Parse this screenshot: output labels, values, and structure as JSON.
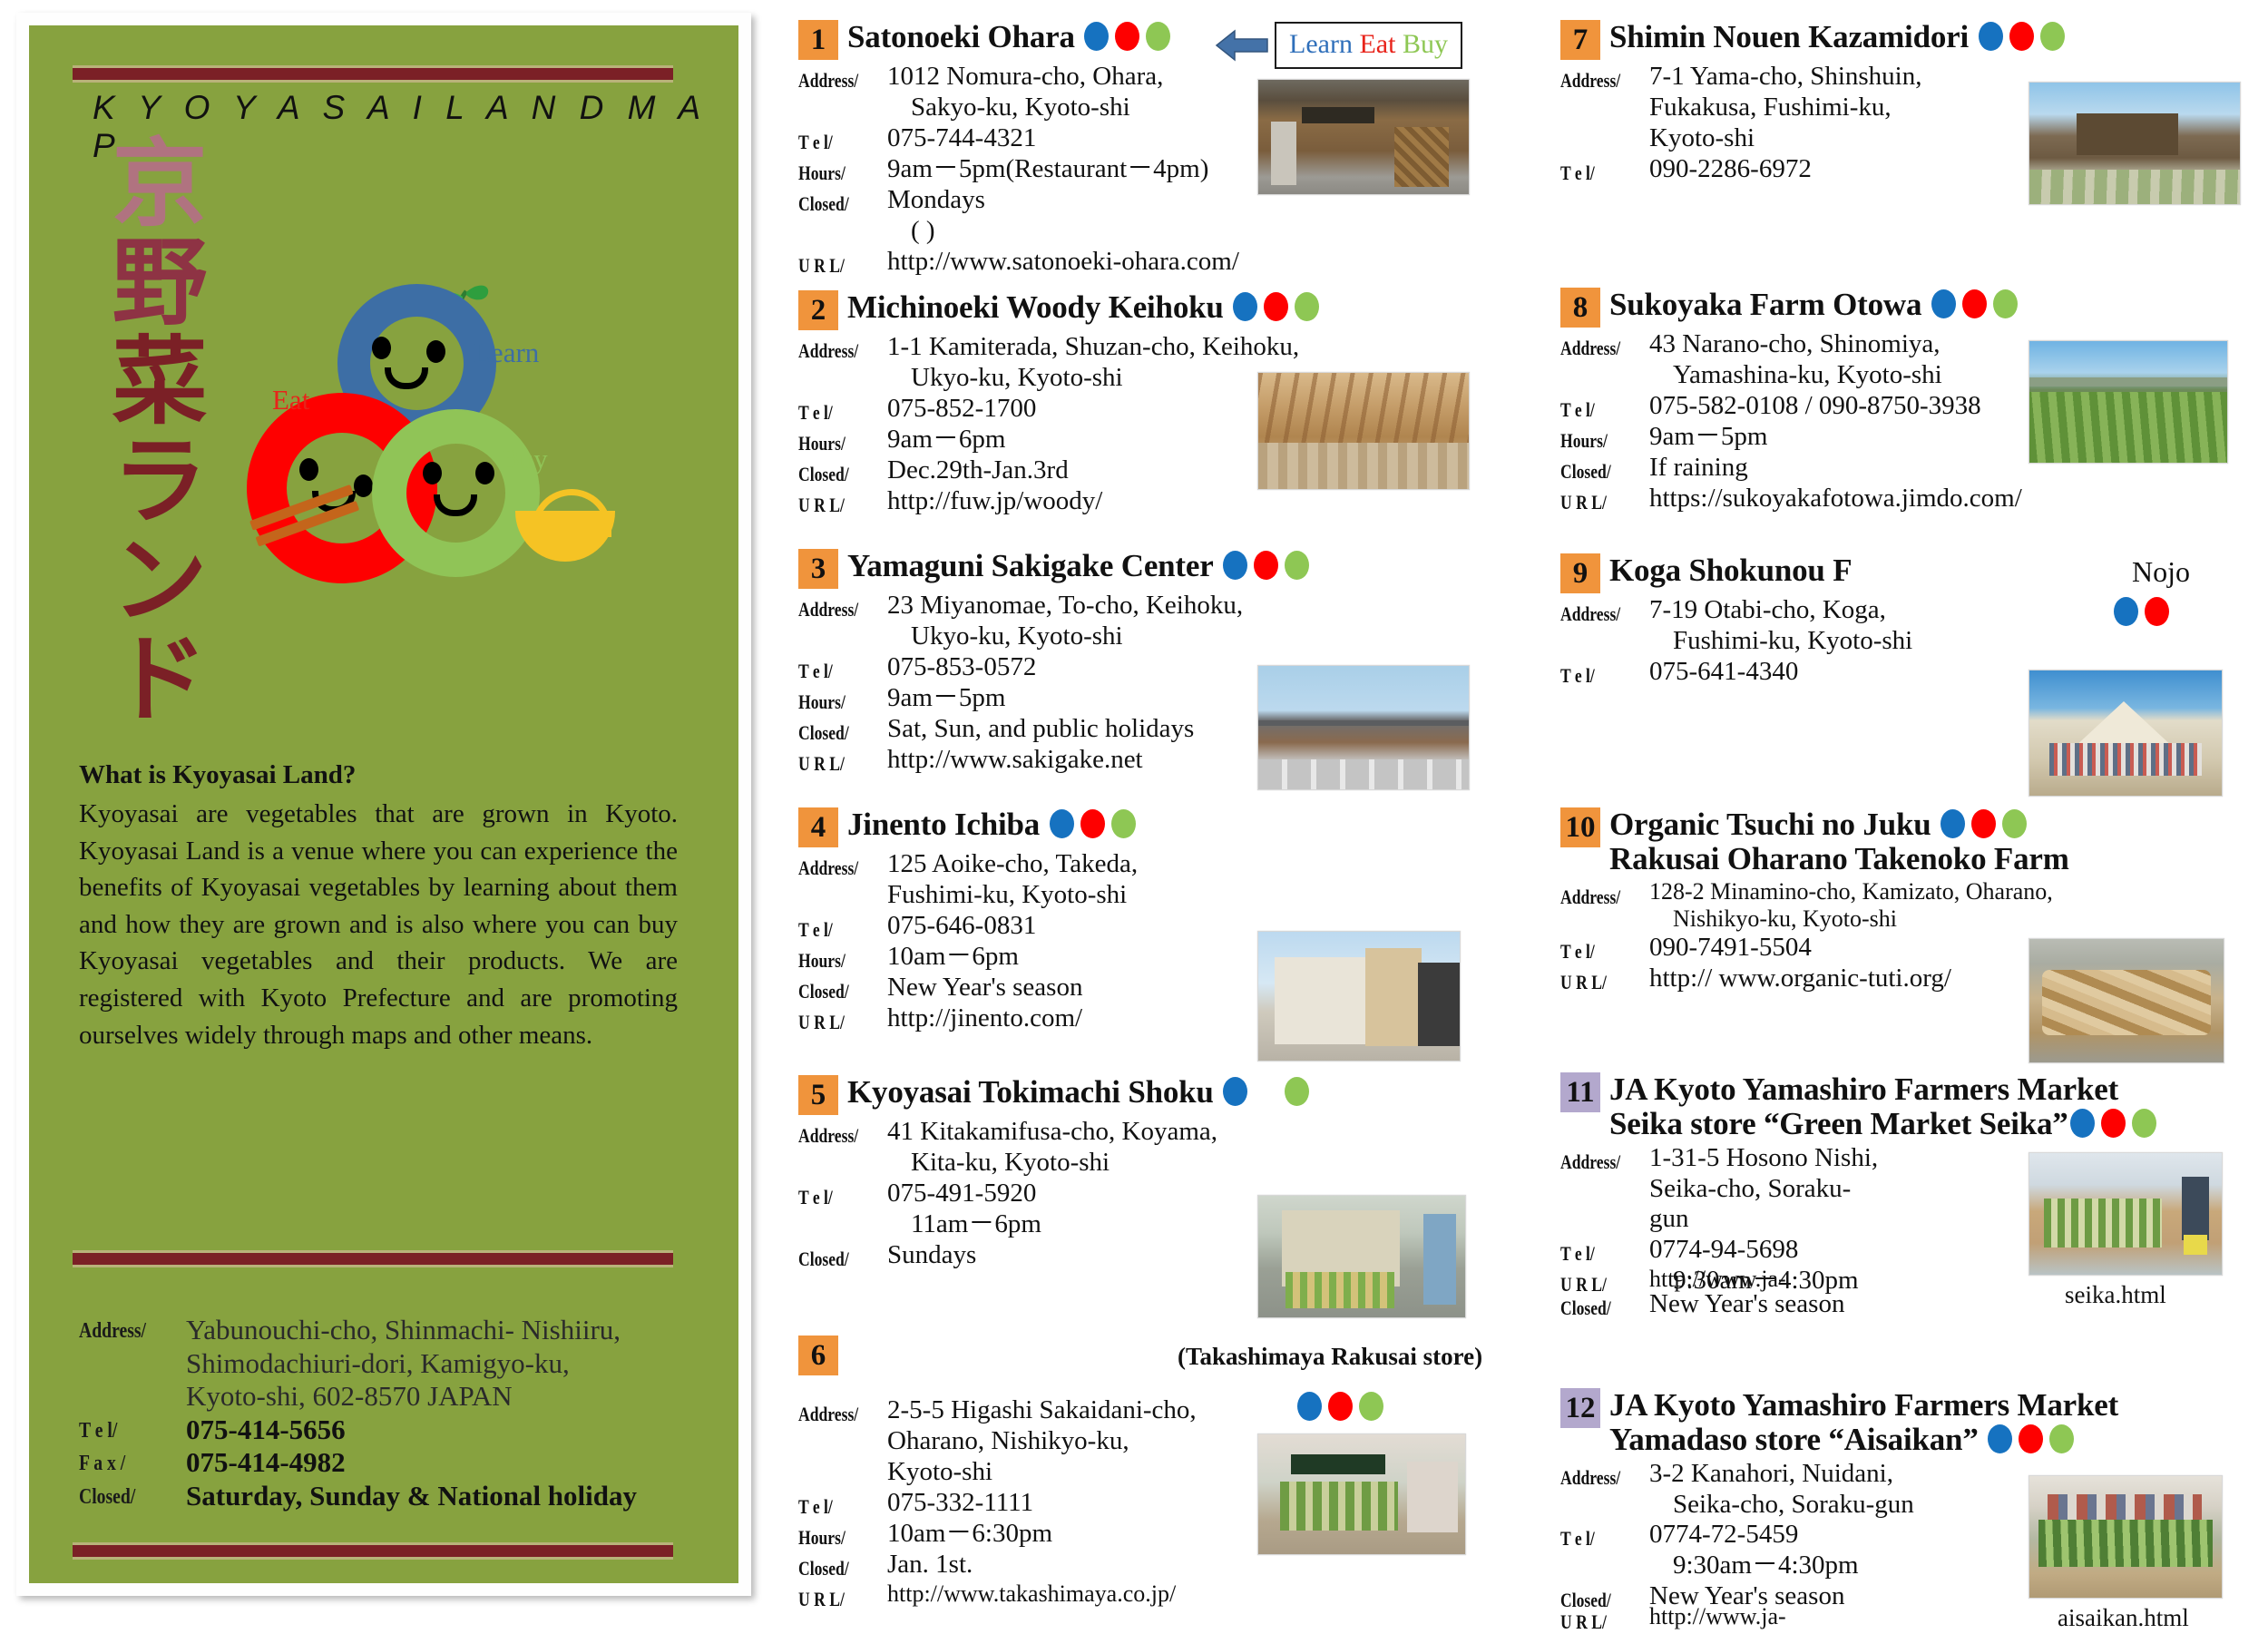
{
  "left_panel": {
    "romaji_title": "K Y O Y A S A I   L A N D   M A P",
    "kanji_lines": [
      "京",
      "野",
      "菜",
      "ラ",
      "ン",
      "ド"
    ],
    "mascot_labels": {
      "learn": "Learn",
      "eat": "Eat",
      "buy": "Buy"
    },
    "about": {
      "heading": "What is Kyoyasai Land?",
      "body": "Kyoyasai are vegetables that are grown in Kyoto. Kyoyasai Land is a venue where you can experience the benefits of Kyoyasai vegetables by learning about them and how they are grown and is also where you can buy Kyoyasai vegetables and their products. We are registered with Kyoto Prefecture and are promoting ourselves widely through maps and other means."
    },
    "contact": {
      "address_label": "Address/",
      "address_l1": "Yabunouchi-cho, Shinmachi- Nishiiru,",
      "address_l2": "Shimodachiuri-dori, Kamigyo-ku,",
      "address_l3": "Kyoto-shi, 602-8570 JAPAN",
      "tel_label": "T e l/",
      "tel": "075-414-5656",
      "fax_label": "F a x /",
      "fax": "075-414-4982",
      "closed_label": "Closed/",
      "closed": "Saturday, Sunday & National holiday"
    }
  },
  "legend": {
    "arrow_icon": "left-arrow-icon",
    "learn": "Learn",
    "eat": "Eat",
    "buy": "Buy"
  },
  "labels": {
    "address": "Address/",
    "tel": "T e l/",
    "hours": "Hours/",
    "closed": "Closed/",
    "url": "U R L/"
  },
  "entries": [
    {
      "num": "1",
      "title": "Satonoeki Ohara",
      "dots": [
        "blue",
        "red",
        "green"
      ],
      "address": [
        "1012 Nomura-cho, Ohara,",
        "Sakyo-ku, Kyoto-shi"
      ],
      "tel": "075-744-4321",
      "hours": "9am－5pm(Restaurant－4pm)",
      "closed": "Mondays",
      "closed_extra": "(                                        )",
      "url": "http://www.satonoeki-ohara.com/",
      "photo": "storefront-photo"
    },
    {
      "num": "2",
      "title": "Michinoeki Woody Keihoku",
      "dots": [
        "blue",
        "red",
        "green"
      ],
      "address": [
        "1-1 Kamiterada, Shuzan-cho, Keihoku,",
        "Ukyo-ku, Kyoto-shi"
      ],
      "tel": "075-852-1700",
      "hours": "9am－6pm",
      "closed": "Dec.29th-Jan.3rd",
      "url": "http://fuw.jp/woody/",
      "photo": "wooden-market-interior-photo"
    },
    {
      "num": "3",
      "title": "Yamaguni Sakigake Center",
      "dots": [
        "blue",
        "red",
        "green"
      ],
      "address": [
        "23 Miyanomae, To-cho, Keihoku,",
        "Ukyo-ku, Kyoto-shi"
      ],
      "tel": "075-853-0572",
      "hours": "9am－5pm",
      "closed": "Sat, Sun, and public holidays",
      "url": "http://www.sakigake.net",
      "photo": "roadside-building-photo"
    },
    {
      "num": "4",
      "title": "Jinento Ichiba",
      "dots": [
        "blue",
        "red",
        "green"
      ],
      "address": [
        "125 Aoike-cho, Takeda,",
        "Fushimi-ku, Kyoto-shi"
      ],
      "tel": "075-646-0831",
      "hours": "10am－6pm",
      "closed": "New Year's season",
      "url": "http://jinento.com/",
      "photo": "white-modern-shop-photo"
    },
    {
      "num": "5",
      "title": "Kyoyasai Tokimachi Shoku",
      "dots": [
        "blue",
        "gap",
        "green"
      ],
      "address": [
        "41 Kitakamifusa-cho, Koyama,",
        "Kita-ku, Kyoto-shi"
      ],
      "tel": "075-491-5920",
      "hours": "11am－6pm",
      "closed": "Sundays",
      "photo": "vegetable-stall-photo"
    },
    {
      "num": "6",
      "title": "",
      "sub_note": "(Takashimaya Rakusai store)",
      "dots": [
        "blue",
        "red",
        "green"
      ],
      "address": [
        "2-5-5 Higashi Sakaidani-cho,",
        "Oharano, Nishikyo-ku,",
        "Kyoto-shi"
      ],
      "tel": "075-332-1111",
      "hours": "10am－6:30pm",
      "closed": "Jan. 1st.",
      "url": "http://www.takashimaya.co.jp/",
      "photo": "department-store-produce-photo"
    },
    {
      "num": "7",
      "title": "Shimin Nouen Kazamidori",
      "dots": [
        "blue",
        "red",
        "green"
      ],
      "address": [
        "7-1 Yama-cho, Shinshuin,",
        "Fukakusa, Fushimi-ku,",
        "Kyoto-shi"
      ],
      "tel": "090-2286-6972",
      "photo": "farmhouse-photo"
    },
    {
      "num": "8",
      "title": "Sukoyaka Farm Otowa",
      "dots": [
        "blue",
        "red",
        "green"
      ],
      "address": [
        "43 Narano-cho, Shinomiya,",
        "Yamashina-ku, Kyoto-shi"
      ],
      "tel": "075-582-0108 / 090-8750-3938",
      "hours": "9am－5pm",
      "closed": "If raining",
      "url": "https://sukoyakafotowa.jimdo.com/",
      "photo": "farm-field-photo"
    },
    {
      "num": "9",
      "title": "Koga Shokunou F",
      "side_note": "Nojo",
      "dots": [
        "blue",
        "red"
      ],
      "address": [
        "7-19 Otabi-cho, Koga,",
        "Fushimi-ku, Kyoto-shi"
      ],
      "tel": "075-641-4340",
      "photo": "group-photo-barn"
    },
    {
      "num": "10",
      "title": "Organic Tsuchi no Juku",
      "title2": "Rakusai Oharano Takenoko Farm",
      "dots": [
        "blue",
        "red",
        "green"
      ],
      "address": [
        "128-2 Minamino-cho, Kamizato,  Oharano,",
        "Nishikyo-ku, Kyoto-shi"
      ],
      "tel": "090-7491-5504",
      "url": "http:// www.organic-tuti.org/",
      "photo": "bamboo-shoots-photo"
    },
    {
      "num": "11",
      "num_color": "purple",
      "title": "JA Kyoto Yamashiro Farmers Market",
      "title2": "Seika store “Green Market Seika”",
      "dots": [
        "blue",
        "red",
        "green"
      ],
      "address": [
        "1-31-5 Hosono Nishi,",
        "Seika-cho, Soraku-",
        "gun"
      ],
      "tel": "0774-94-5698",
      "hours": "9:30am－4:30pm",
      "url": "http://www.ja-",
      "closed": "New Year's season",
      "photo": "green-market-seika-photo",
      "caption": "seika.html"
    },
    {
      "num": "12",
      "num_color": "purple",
      "title": "JA Kyoto Yamashiro Farmers Market",
      "title2": "Yamadaso store “Aisaikan”",
      "dots": [
        "blue",
        "red",
        "green"
      ],
      "address": [
        "3-2 Kanahori, Nuidani,",
        "Seika-cho, Soraku-gun"
      ],
      "tel": "0774-72-5459",
      "hours": "9:30am－4:30pm",
      "closed": "New Year's season",
      "url": "http://www.ja-",
      "photo": "aisaikan-market-photo",
      "caption": "aisaikan.html"
    }
  ]
}
